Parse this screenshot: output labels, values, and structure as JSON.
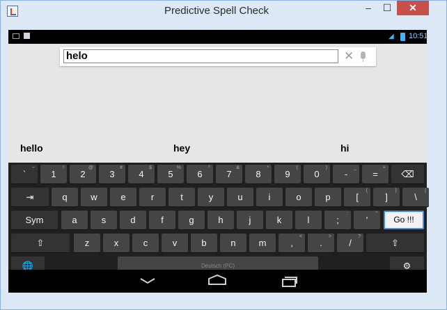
{
  "window": {
    "title": "Predictive Spell Check",
    "minimize": "–",
    "maximize": "☐",
    "close": "✕"
  },
  "statusbar": {
    "time": "10:51"
  },
  "search": {
    "value": "helo",
    "clear_icon": "✕"
  },
  "suggestions": [
    "hello",
    "hey",
    "hi"
  ],
  "keyboard": {
    "row1": [
      {
        "label": "`",
        "hint": "~"
      },
      {
        "label": "1",
        "hint": "!"
      },
      {
        "label": "2",
        "hint": "@"
      },
      {
        "label": "3",
        "hint": "#"
      },
      {
        "label": "4",
        "hint": "$"
      },
      {
        "label": "5",
        "hint": "%"
      },
      {
        "label": "6",
        "hint": "^"
      },
      {
        "label": "7",
        "hint": "&"
      },
      {
        "label": "8",
        "hint": "*"
      },
      {
        "label": "9",
        "hint": "("
      },
      {
        "label": "0",
        "hint": ")"
      },
      {
        "label": "-",
        "hint": "_"
      },
      {
        "label": "=",
        "hint": "+"
      }
    ],
    "delete": "⌫",
    "tab": "⇥",
    "row2": [
      "q",
      "w",
      "e",
      "r",
      "t",
      "y",
      "u",
      "i",
      "o",
      "p",
      "[",
      "]",
      "\\"
    ],
    "row2_hints": [
      "",
      "",
      "",
      "",
      "",
      "",
      "",
      "",
      "",
      "",
      "{",
      "}",
      "|"
    ],
    "sym": "Sym",
    "row3": [
      "a",
      "s",
      "d",
      "f",
      "g",
      "h",
      "j",
      "k",
      "l",
      ";",
      "'"
    ],
    "row3_hints": [
      "",
      "",
      "",
      "",
      "",
      "",
      "",
      "",
      "",
      ":",
      "\""
    ],
    "go": "Go !!!",
    "shift": "⇧",
    "row4": [
      "z",
      "x",
      "c",
      "v",
      "b",
      "n",
      "m",
      ",",
      ".",
      "/"
    ],
    "row4_hints": [
      "",
      "",
      "",
      "",
      "",
      "",
      "",
      "<",
      ">",
      "?"
    ],
    "globe": "🌐",
    "space": "Deutsch (PC)",
    "settings": "⚙"
  }
}
